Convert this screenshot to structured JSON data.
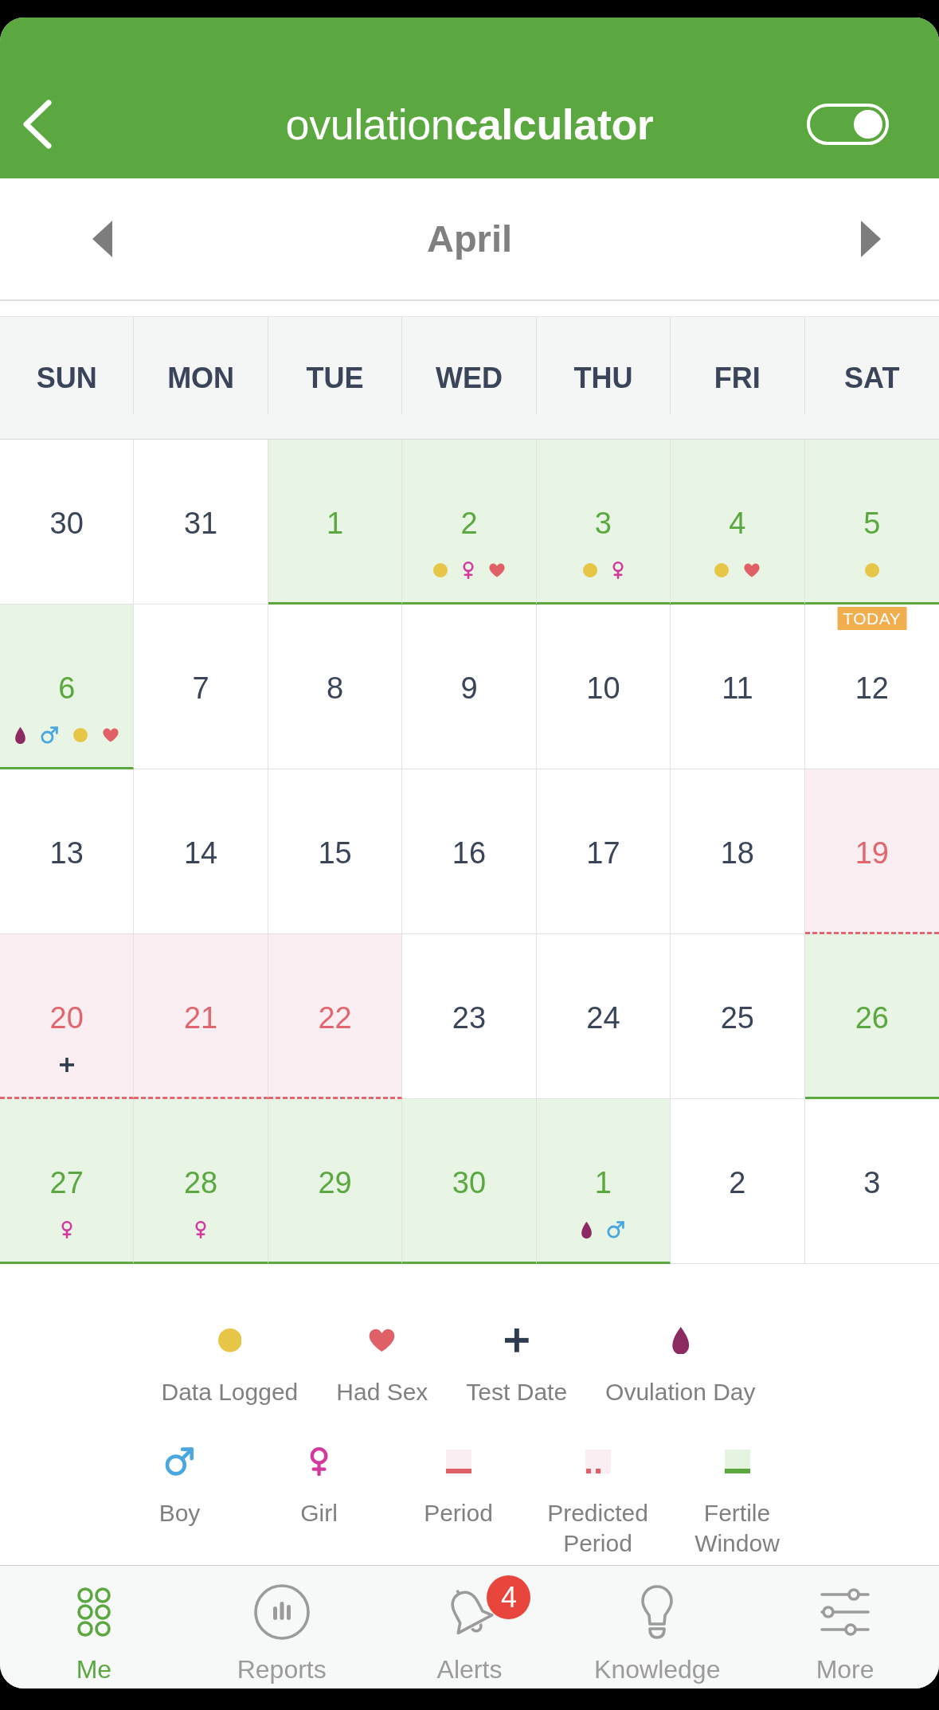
{
  "header": {
    "logo": "ovulation**calculator**",
    "toggle": {
      "on": true
    }
  },
  "month": "April",
  "weekdays": [
    "SUN",
    "MON",
    "TUE",
    "WED",
    "THU",
    "FRI",
    "SAT"
  ],
  "weeks": [
    {
      "days": [
        {
          "day": "30",
          "kind": "plain"
        },
        {
          "day": "31",
          "kind": "plain"
        },
        {
          "day": "1",
          "kind": "fertile"
        },
        {
          "day": "2",
          "kind": "fertile",
          "markers": [
            {
              "kind": "data_logged"
            },
            {
              "kind": "girl"
            },
            {
              "kind": "had_sex"
            }
          ]
        },
        {
          "day": "3",
          "kind": "fertile",
          "markers": [
            {
              "kind": "data_logged"
            },
            {
              "kind": "girl"
            }
          ]
        },
        {
          "day": "4",
          "kind": "fertile",
          "markers": [
            {
              "kind": "data_logged"
            },
            {
              "kind": "had_sex"
            }
          ]
        },
        {
          "day": "5",
          "kind": "fertile",
          "markers": [
            {
              "kind": "data_logged"
            }
          ]
        }
      ]
    },
    {
      "days": [
        {
          "day": "6",
          "kind": "fertile",
          "markers": [
            {
              "kind": "ovulation"
            },
            {
              "kind": "boy"
            },
            {
              "kind": "data_logged"
            },
            {
              "kind": "had_sex"
            }
          ]
        },
        {
          "day": "7",
          "kind": "plain"
        },
        {
          "day": "8",
          "kind": "plain"
        },
        {
          "day": "9",
          "kind": "plain"
        },
        {
          "day": "10",
          "kind": "plain"
        },
        {
          "day": "11",
          "kind": "plain"
        },
        {
          "day": "12",
          "kind": "plain",
          "badge": "TODAY"
        }
      ]
    },
    {
      "days": [
        {
          "day": "13",
          "kind": "plain"
        },
        {
          "day": "14",
          "kind": "plain"
        },
        {
          "day": "15",
          "kind": "plain"
        },
        {
          "day": "16",
          "kind": "plain"
        },
        {
          "day": "17",
          "kind": "plain"
        },
        {
          "day": "18",
          "kind": "plain"
        },
        {
          "day": "19",
          "kind": "predicted_period"
        }
      ]
    },
    {
      "days": [
        {
          "day": "20",
          "kind": "predicted_period",
          "markers": [
            {
              "kind": "test_date"
            }
          ]
        },
        {
          "day": "21",
          "kind": "predicted_period"
        },
        {
          "day": "22",
          "kind": "predicted_period"
        },
        {
          "day": "23",
          "kind": "plain"
        },
        {
          "day": "24",
          "kind": "plain"
        },
        {
          "day": "25",
          "kind": "plain"
        },
        {
          "day": "26",
          "kind": "fertile"
        }
      ]
    },
    {
      "days": [
        {
          "day": "27",
          "kind": "fertile",
          "markers": [
            {
              "kind": "girl"
            }
          ]
        },
        {
          "day": "28",
          "kind": "fertile",
          "markers": [
            {
              "kind": "girl"
            }
          ]
        },
        {
          "day": "29",
          "kind": "fertile"
        },
        {
          "day": "30",
          "kind": "fertile"
        },
        {
          "day": "1",
          "kind": "fertile",
          "markers": [
            {
              "kind": "ovulation"
            },
            {
              "kind": "boy"
            }
          ]
        },
        {
          "day": "2",
          "kind": "plain"
        },
        {
          "day": "3",
          "kind": "plain"
        }
      ]
    }
  ],
  "legend_rows": [
    {
      "items": [
        {
          "kind": "data_logged",
          "label": "Data Logged"
        },
        {
          "kind": "had_sex",
          "label": "Had Sex"
        },
        {
          "kind": "test_date",
          "label": "Test Date"
        },
        {
          "kind": "ovulation",
          "label": "Ovulation Day"
        }
      ]
    },
    {
      "items": [
        {
          "kind": "boy",
          "label": "Boy"
        },
        {
          "kind": "girl",
          "label": "Girl"
        },
        {
          "kind": "period",
          "label": "Period"
        },
        {
          "kind": "predicted_period",
          "label": "Predicted Period"
        },
        {
          "kind": "fertile",
          "label": "Fertile Window"
        }
      ]
    }
  ],
  "tab_bar": [
    {
      "kind": "me",
      "label": "Me",
      "selected": true
    },
    {
      "kind": "reports",
      "label": "Reports",
      "selected": false
    },
    {
      "kind": "alerts",
      "label": "Alerts",
      "selected": false,
      "badge": "4"
    },
    {
      "kind": "knowledge",
      "label": "Knowledge",
      "selected": false
    },
    {
      "kind": "more",
      "label": "More",
      "selected": false
    }
  ]
}
